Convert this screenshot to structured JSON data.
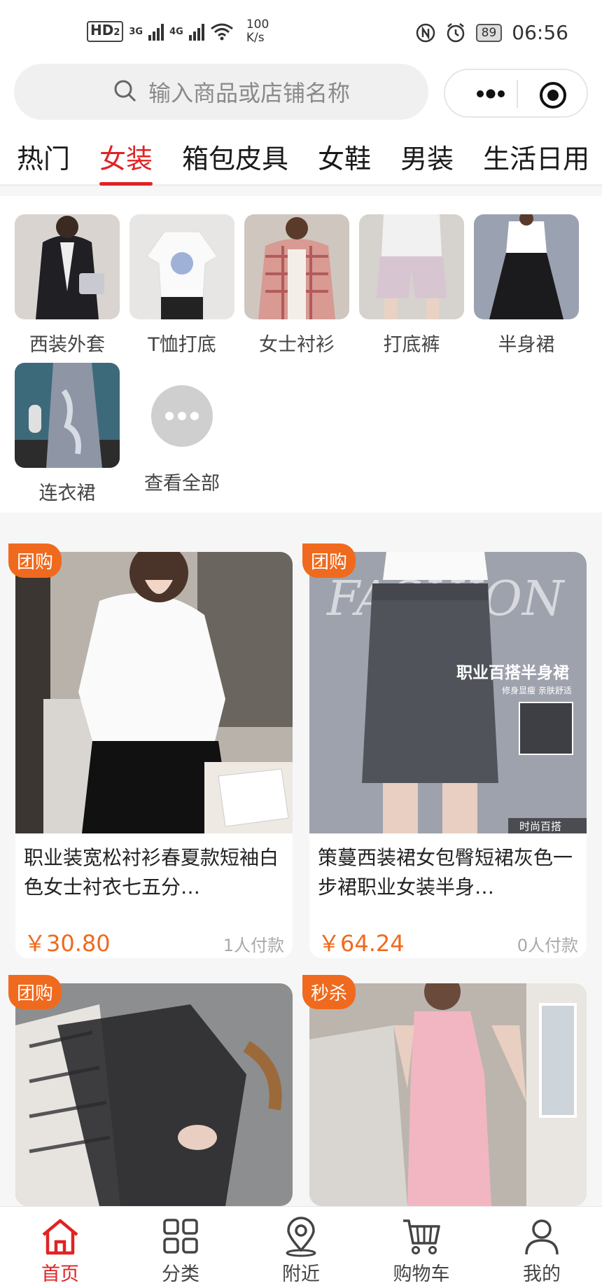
{
  "status_bar": {
    "hd": "HD",
    "hd_sub": "2",
    "net1": "3G",
    "net2": "4G",
    "speed_value": "100",
    "speed_unit": "K/s",
    "battery": "89",
    "time": "06:56"
  },
  "search": {
    "placeholder": "输入商品或店铺名称"
  },
  "tabs": [
    {
      "label": "热门",
      "active": false
    },
    {
      "label": "女装",
      "active": true
    },
    {
      "label": "箱包皮具",
      "active": false
    },
    {
      "label": "女鞋",
      "active": false
    },
    {
      "label": "男装",
      "active": false
    },
    {
      "label": "生活日用",
      "active": false
    }
  ],
  "subcategories": [
    {
      "label": "西装外套"
    },
    {
      "label": "T恤打底"
    },
    {
      "label": "女士衬衫"
    },
    {
      "label": "打底裤"
    },
    {
      "label": "半身裙"
    },
    {
      "label": "连衣裙"
    },
    {
      "label": "查看全部"
    }
  ],
  "products": [
    {
      "badge": "团购",
      "name": "职业装宽松衬衫春夏款短袖白色女士衬衣七五分…",
      "price": "￥30.80",
      "sold": "1人付款"
    },
    {
      "badge": "团购",
      "name": "策蔓西装裙女包臀短裙灰色一步裙职业女装半身…",
      "price": "￥64.24",
      "sold": "0人付款",
      "photo_text_1": "职业百搭半身裙",
      "photo_text_2": "修身显瘦 亲肤舒适",
      "photo_text_3": "时尚百搭",
      "photo_text_4": "FASHION"
    },
    {
      "badge": "团购"
    },
    {
      "badge": "秒杀"
    }
  ],
  "bottom_nav": [
    {
      "label": "首页",
      "icon": "home-icon",
      "active": true
    },
    {
      "label": "分类",
      "icon": "grid-icon",
      "active": false
    },
    {
      "label": "附近",
      "icon": "location-pin-icon",
      "active": false
    },
    {
      "label": "购物车",
      "icon": "cart-icon",
      "active": false
    },
    {
      "label": "我的",
      "icon": "user-icon",
      "active": false
    }
  ],
  "colors": {
    "accent": "#e02323",
    "price": "#ef6a1e",
    "badge": "#ef6a1e"
  }
}
